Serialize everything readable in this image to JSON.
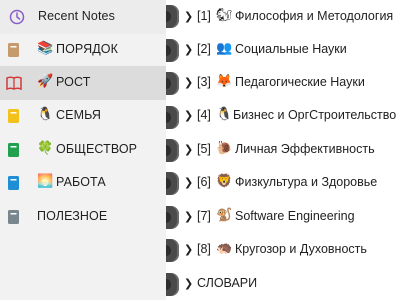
{
  "sidebar": {
    "items": [
      {
        "label": "Recent Notes",
        "icon": "clock-icon",
        "color": "#8a5cc9",
        "emoji": ""
      },
      {
        "label": "ПОРЯДОК",
        "icon": "notebook-icon",
        "color": "#c79a6e",
        "emoji": "📚"
      },
      {
        "label": "РОСТ",
        "icon": "open-book-icon",
        "color": "#d23a3a",
        "emoji": "🚀"
      },
      {
        "label": "СЕМЬЯ",
        "icon": "notebook-icon",
        "color": "#f2c21a",
        "emoji": "🐧"
      },
      {
        "label": "ОБЩЕСТВОР",
        "icon": "notebook-icon",
        "color": "#22a050",
        "emoji": "🍀"
      },
      {
        "label": "РАБОТА",
        "icon": "notebook-icon",
        "color": "#1e8fd6",
        "emoji": "🌅"
      },
      {
        "label": "ПОЛЕЗНОЕ",
        "icon": "notebook-icon",
        "color": "#7a868e",
        "emoji": ""
      }
    ]
  },
  "list": {
    "items": [
      {
        "num": "[1]",
        "emoji": "🐿",
        "label": "Философия и Методология"
      },
      {
        "num": "[2]",
        "emoji": "👥",
        "label": "Социальные Науки"
      },
      {
        "num": "[3]",
        "emoji": "🦊",
        "label": "Педагогические Науки"
      },
      {
        "num": "[4]",
        "emoji": "🐧",
        "label": "Бизнес и ОргСтроительство"
      },
      {
        "num": "[5]",
        "emoji": "🐌",
        "label": "Личная Эффективность"
      },
      {
        "num": "[6]",
        "emoji": "🦁",
        "label": "Физкультура и Здоровье"
      },
      {
        "num": "[7]",
        "emoji": "🐒",
        "label": "Software Engineering"
      },
      {
        "num": "[8]",
        "emoji": "🦔",
        "label": "Кругозор и Духовность"
      },
      {
        "num": "",
        "emoji": "",
        "label": "СЛОВАРИ"
      }
    ]
  }
}
